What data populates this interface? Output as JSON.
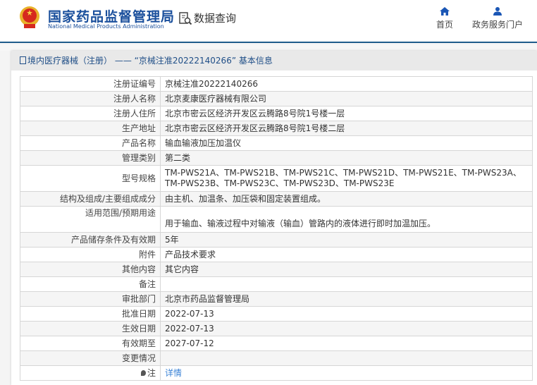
{
  "header": {
    "logo_cn": "国家药品监督管理局",
    "logo_en": "National Medical Products Administration",
    "data_query": "数据查询",
    "nav": [
      {
        "label": "首页",
        "icon": "home-icon"
      },
      {
        "label": "政务服务门户",
        "icon": "user-icon"
      }
    ],
    "accent": "#1a4f9c"
  },
  "panel": {
    "title": "境内医疗器械（注册） —— “京械注准20222140266” 基本信息",
    "rows": [
      {
        "label": "注册证编号",
        "value": "京械注准20222140266"
      },
      {
        "label": "注册人名称",
        "value": "北京麦康医疗器械有限公司"
      },
      {
        "label": "注册人住所",
        "value": "北京市密云区经济开发区云腾路8号院1号楼一层"
      },
      {
        "label": "生产地址",
        "value": "北京市密云区经济开发区云腾路8号院1号楼二层"
      },
      {
        "label": "产品名称",
        "value": "输血输液加压加温仪"
      },
      {
        "label": "管理类别",
        "value": "第二类"
      },
      {
        "label": "型号规格",
        "value": "TM-PWS21A、TM-PWS21B、TM-PWS21C、TM-PWS21D、TM-PWS21E、TM-PWS23A、TM-PWS23B、TM-PWS23C、TM-PWS23D、TM-PWS23E"
      },
      {
        "label": "结构及组成/主要组成成分",
        "value": "由主机、加温条、加压袋和固定装置组成。"
      },
      {
        "label": "适用范围/预期用途",
        "value": "用于输血、输液过程中对输液（输血）管路内的液体进行即时加温加压。"
      },
      {
        "label": "产品储存条件及有效期",
        "value": "5年"
      },
      {
        "label": "附件",
        "value": "产品技术要求"
      },
      {
        "label": "其他内容",
        "value": "其它内容"
      },
      {
        "label": "备注",
        "value": ""
      },
      {
        "label": "审批部门",
        "value": "北京市药品监督管理局"
      },
      {
        "label": "批准日期",
        "value": "2022-07-13"
      },
      {
        "label": "生效日期",
        "value": "2022-07-13"
      },
      {
        "label": "有效期至",
        "value": "2027-07-12"
      },
      {
        "label": "变更情况",
        "value": ""
      }
    ],
    "note": {
      "label": "注",
      "link": "详情"
    }
  }
}
